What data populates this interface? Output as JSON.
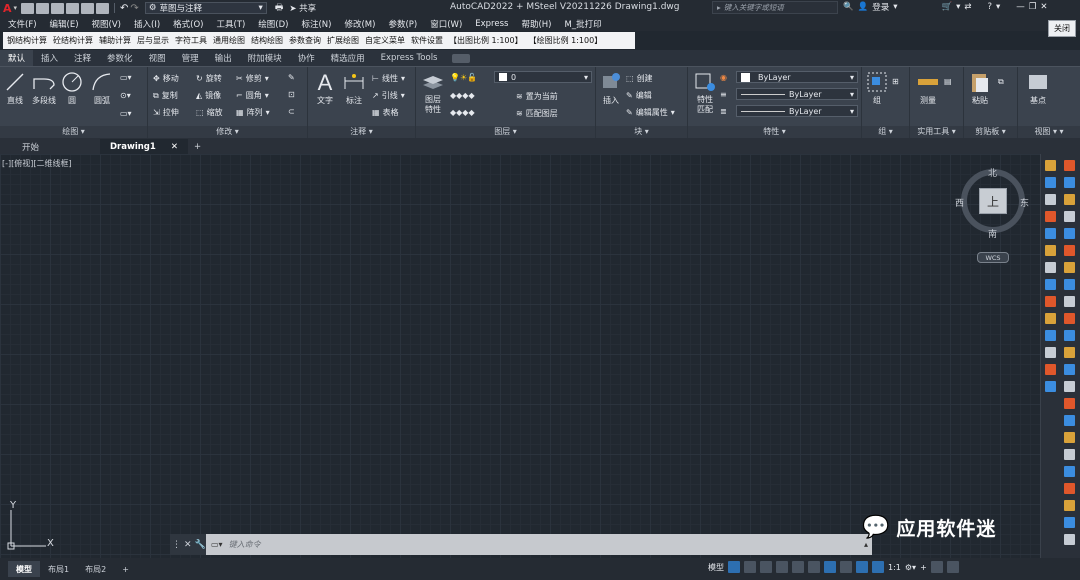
{
  "title_bar": {
    "workspace": "草图与注释",
    "share": "共享",
    "app_title": "AutoCAD2022 + MSteel V20211226   Drawing1.dwg",
    "search_placeholder": "键入关键字或短语",
    "login": "登录"
  },
  "menu": [
    "文件(F)",
    "编辑(E)",
    "视图(V)",
    "插入(I)",
    "格式(O)",
    "工具(T)",
    "绘图(D)",
    "标注(N)",
    "修改(M)",
    "参数(P)",
    "窗口(W)",
    "Express",
    "帮助(H)",
    "M_批打印"
  ],
  "msteel_toolbar": [
    "钢结构计算",
    "砼结构计算",
    "辅助计算",
    "层与显示",
    "字符工具",
    "通用绘图",
    "结构绘图",
    "参数查询",
    "扩展绘图",
    "自定义菜单",
    "软件设置",
    "【出图比例 1:100】",
    "【绘图比例 1:100】"
  ],
  "tooltip": "关闭",
  "ribbon_tabs": [
    "默认",
    "插入",
    "注释",
    "参数化",
    "视图",
    "管理",
    "输出",
    "附加模块",
    "协作",
    "精选应用",
    "Express Tools"
  ],
  "ribbon": {
    "draw": {
      "line": "直线",
      "polyline": "多段线",
      "circle": "圆",
      "arc": "圆弧",
      "title": "绘图"
    },
    "modify": {
      "move": "移动",
      "rotate": "旋转",
      "trim": "修剪",
      "copy": "复制",
      "mirror": "镜像",
      "fillet": "圆角",
      "stretch": "拉伸",
      "scale": "缩放",
      "array": "阵列",
      "title": "修改"
    },
    "annotation": {
      "text": "文字",
      "dimension": "标注",
      "linear": "线性",
      "leader": "引线",
      "table": "表格",
      "title": "注释"
    },
    "layers": {
      "layer_props": "图层\n特性",
      "layer_value": "0",
      "set_current": "置为当前",
      "match_layer": "匹配图层",
      "title": "图层"
    },
    "block": {
      "insert": "插入",
      "create": "创建",
      "edit": "编辑",
      "edit_attr": "编辑属性",
      "title": "块"
    },
    "properties": {
      "match": "特性\n匹配",
      "color": "ByLayer",
      "linetype": "ByLayer",
      "lineweight": "ByLayer",
      "title": "特性"
    },
    "group": {
      "group": "组",
      "title": "组"
    },
    "utilities": {
      "measure": "测量",
      "title": "实用工具"
    },
    "clipboard": {
      "paste": "粘贴",
      "title": "剪贴板"
    },
    "view": {
      "base": "基点",
      "title": "视图"
    }
  },
  "file_tabs": {
    "start": "开始",
    "drawing": "Drawing1"
  },
  "viewport_label": "[-][俯视][二维线框]",
  "viewcube": {
    "top": "上",
    "north": "北",
    "south": "南",
    "east": "东",
    "west": "西",
    "wcs": "WCS"
  },
  "ucs": {
    "x": "X",
    "y": "Y"
  },
  "command_placeholder": "键入命令",
  "watermark": "应用软件迷",
  "layout_tabs": [
    "模型",
    "布局1",
    "布局2"
  ],
  "status": {
    "model": "模型",
    "scale": "1:1"
  }
}
